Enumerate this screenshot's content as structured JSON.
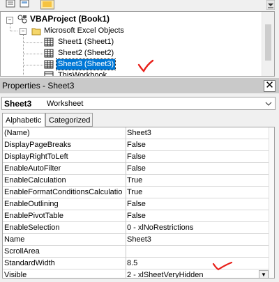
{
  "tree": {
    "root": "VBAProject (Book1)",
    "folder": "Microsoft Excel Objects",
    "items": [
      "Sheet1 (Sheet1)",
      "Sheet2 (Sheet2)",
      "Sheet3 (Sheet3)"
    ],
    "partial_item": "ThisWorkbook"
  },
  "properties": {
    "title": "Properties - Sheet3",
    "close": "✕",
    "object_name": "Sheet3",
    "object_type": "Worksheet",
    "tabs": [
      "Alphabetic",
      "Categorized"
    ],
    "rows": [
      {
        "name": "(Name)",
        "value": "Sheet3"
      },
      {
        "name": "DisplayPageBreaks",
        "value": "False"
      },
      {
        "name": "DisplayRightToLeft",
        "value": "False"
      },
      {
        "name": "EnableAutoFilter",
        "value": "False"
      },
      {
        "name": "EnableCalculation",
        "value": "True"
      },
      {
        "name": "EnableFormatConditionsCalculation",
        "value": "True"
      },
      {
        "name": "EnableOutlining",
        "value": "False"
      },
      {
        "name": "EnablePivotTable",
        "value": "False"
      },
      {
        "name": "EnableSelection",
        "value": "0 - xlNoRestrictions"
      },
      {
        "name": "Name",
        "value": "Sheet3"
      },
      {
        "name": "ScrollArea",
        "value": ""
      },
      {
        "name": "StandardWidth",
        "value": "8.5"
      },
      {
        "name": "Visible",
        "value": "2 - xlSheetVeryHidden"
      }
    ]
  },
  "colors": {
    "selection": "#0078d7",
    "annotation": "#e8201a"
  }
}
